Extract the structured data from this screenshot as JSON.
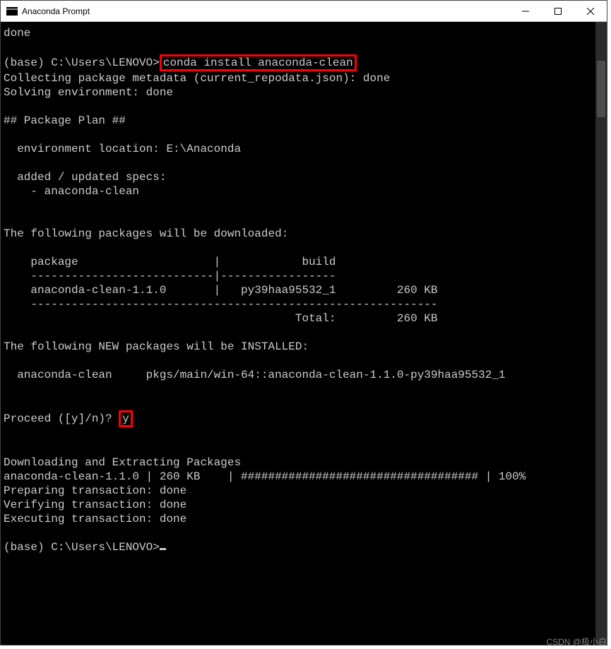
{
  "window": {
    "title": "Anaconda Prompt"
  },
  "term": {
    "l01": "done",
    "l02": "",
    "l03a": "(base) C:\\Users\\LENOVO>",
    "l03b": "conda install anaconda-clean",
    "l04": "Collecting package metadata (current_repodata.json): done",
    "l05": "Solving environment: done",
    "l06": "",
    "l07": "## Package Plan ##",
    "l08": "",
    "l09": "  environment location: E:\\Anaconda",
    "l10": "",
    "l11": "  added / updated specs:",
    "l12": "    - anaconda-clean",
    "l13": "",
    "l14": "",
    "l15": "The following packages will be downloaded:",
    "l16": "",
    "l17": "    package                    |            build",
    "l18": "    ---------------------------|-----------------",
    "l19": "    anaconda-clean-1.1.0       |   py39haa95532_1         260 KB",
    "l20": "    ------------------------------------------------------------",
    "l21": "                                           Total:         260 KB",
    "l22": "",
    "l23": "The following NEW packages will be INSTALLED:",
    "l24": "",
    "l25": "  anaconda-clean     pkgs/main/win-64::anaconda-clean-1.1.0-py39haa95532_1",
    "l26": "",
    "l27": "",
    "l28a": "Proceed ([y]/n)? ",
    "l28b": "y",
    "l29": "",
    "l30": "",
    "l31": "Downloading and Extracting Packages",
    "l32": "anaconda-clean-1.1.0 | 260 KB    | ################################### | 100%",
    "l33": "Preparing transaction: done",
    "l34": "Verifying transaction: done",
    "l35": "Executing transaction: done",
    "l36": "",
    "l37": "(base) C:\\Users\\LENOVO>"
  },
  "watermark": "CSDN @极小白"
}
